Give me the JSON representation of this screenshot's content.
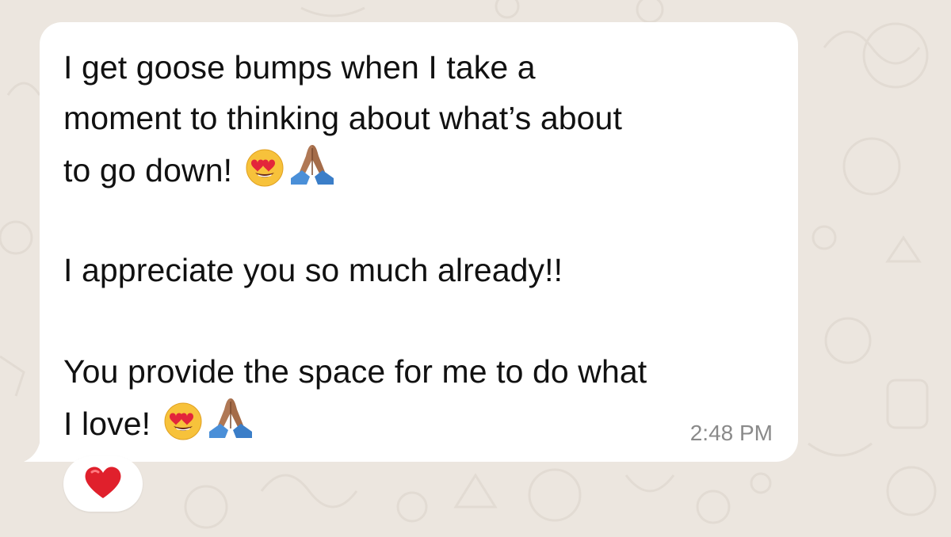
{
  "message": {
    "lines": [
      "I get goose bumps when I take a",
      "moment to thinking about what’s about",
      "to go down!",
      "",
      "I appreciate you so much already!!",
      "",
      "You provide the space for me to do what",
      "I love!"
    ],
    "line3_emojis": [
      "heart-eyes-emoji",
      "praying-hands-emoji"
    ],
    "line8_emojis": [
      "heart-eyes-emoji",
      "praying-hands-emoji"
    ],
    "timestamp": "2:48 PM"
  },
  "reaction": {
    "emoji": "red-heart-emoji"
  },
  "colors": {
    "wallpaper": "#ece6df",
    "bubble": "#ffffff",
    "text": "#111111",
    "timestamp": "#8a8a8a",
    "heart": "#e0202c"
  }
}
